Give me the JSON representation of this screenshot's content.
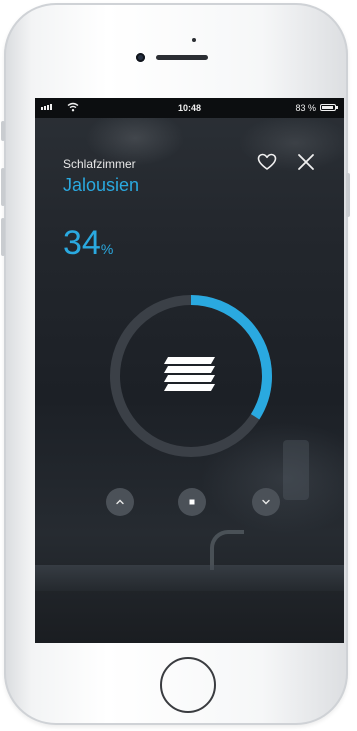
{
  "status_bar": {
    "time": "10:48",
    "battery_text": "83 %",
    "signal_icon": "signal-bars-icon",
    "wifi_icon": "wifi-icon",
    "battery_icon": "battery-icon"
  },
  "header": {
    "room": "Schlafzimmer",
    "device": "Jalousien",
    "favorite_icon": "heart-icon",
    "close_icon": "close-icon"
  },
  "position": {
    "value": "34",
    "unit": "%",
    "level": 0.34
  },
  "dial": {
    "icon": "blinds-icon"
  },
  "controls": {
    "up_icon": "chevron-up-icon",
    "stop_icon": "stop-icon",
    "down_icon": "chevron-down-icon"
  },
  "colors": {
    "accent": "#2aa9e0",
    "track": "#3b4047"
  }
}
